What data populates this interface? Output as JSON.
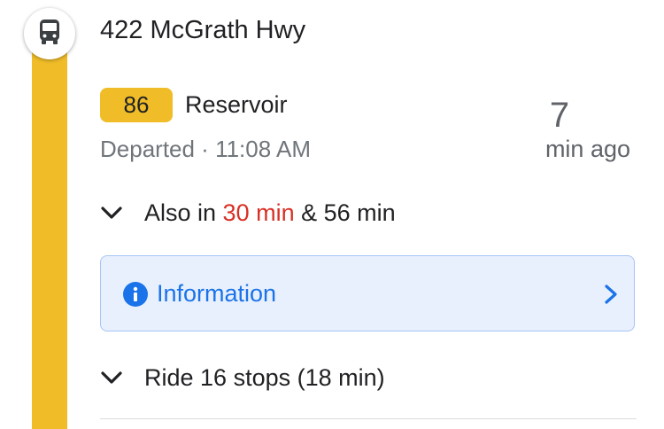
{
  "colors": {
    "route_line": "#f0bd28",
    "route_badge": "#f0bd28",
    "info_background": "#e8f0fe",
    "info_text": "#1a73e8",
    "highlight_red": "#d93025"
  },
  "stop": {
    "icon": "bus-icon",
    "name": "422 McGrath Hwy"
  },
  "departure": {
    "route_number": "86",
    "destination": "Reservoir",
    "status_text": "Departed · 11:08 AM",
    "minutes_value": "7",
    "minutes_unit": "min ago"
  },
  "also": {
    "icon": "chevron-down-icon",
    "prefix": "Also in ",
    "first_time": "30 min",
    "separator": " & ",
    "second_time": "56 min"
  },
  "information": {
    "icon": "info-icon",
    "label": "Information",
    "chevron_icon": "chevron-right-icon"
  },
  "ride": {
    "icon": "chevron-down-icon",
    "label": "Ride 16 stops (18 min)"
  }
}
